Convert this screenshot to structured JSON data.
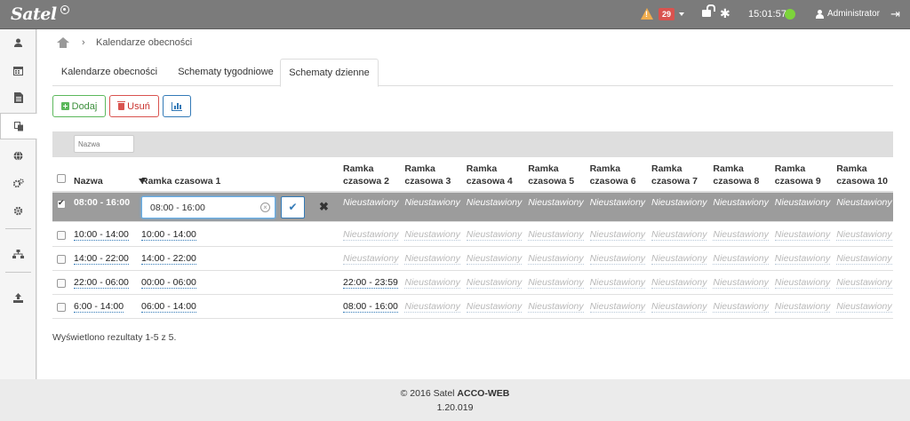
{
  "topbar": {
    "logo": "Satel",
    "alarm_count": "29",
    "clock": "15:01:57",
    "user": "Administrator",
    "colors": {
      "bar": "#7b7b7b",
      "warning": "#f0ad4e",
      "alarm": "#d9534f",
      "status_ok": "#7dd33b"
    }
  },
  "sidebar": {
    "items": [
      {
        "icon": "user-icon"
      },
      {
        "icon": "calendar-icon"
      },
      {
        "icon": "document-icon"
      },
      {
        "icon": "copy-icon",
        "active": true
      },
      {
        "icon": "globe-icon"
      },
      {
        "icon": "cogs-icon"
      },
      {
        "icon": "gear-icon"
      },
      {
        "icon": "network-icon"
      },
      {
        "icon": "upload-icon"
      }
    ]
  },
  "breadcrumb": {
    "current": "Kalendarze obecności"
  },
  "tabs": [
    {
      "label": "Kalendarze obecności"
    },
    {
      "label": "Schematy tygodniowe"
    },
    {
      "label": "Schematy dzienne",
      "active": true
    }
  ],
  "toolbar": {
    "add_label": "Dodaj",
    "delete_label": "Usuń"
  },
  "filter": {
    "placeholder": "Nazwa",
    "value": ""
  },
  "table": {
    "headers": {
      "name": "Nazwa",
      "frame1": "Ramka czasowa 1",
      "frames": [
        [
          "Ramka",
          "czasowa 2"
        ],
        [
          "Ramka",
          "czasowa 3"
        ],
        [
          "Ramka",
          "czasowa 4"
        ],
        [
          "Ramka",
          "czasowa 5"
        ],
        [
          "Ramka",
          "czasowa 6"
        ],
        [
          "Ramka",
          "czasowa 7"
        ],
        [
          "Ramka",
          "czasowa 8"
        ],
        [
          "Ramka",
          "czasowa 9"
        ],
        [
          "Ramka",
          "czasowa 10"
        ]
      ]
    },
    "rows": [
      {
        "name": "08:00 - 16:00",
        "frame1": "08:00 - 16:00",
        "checked": true,
        "editing": true,
        "frames": [
          "Nieustawiony",
          "Nieustawiony",
          "Nieustawiony",
          "Nieustawiony",
          "Nieustawiony",
          "Nieustawiony",
          "Nieustawiony",
          "Nieustawiony",
          "Nieustawiony"
        ]
      },
      {
        "name": "10:00 - 14:00",
        "frame1": "10:00 - 14:00",
        "checked": false,
        "frames": [
          "Nieustawiony",
          "Nieustawiony",
          "Nieustawiony",
          "Nieustawiony",
          "Nieustawiony",
          "Nieustawiony",
          "Nieustawiony",
          "Nieustawiony",
          "Nieustawiony"
        ]
      },
      {
        "name": "14:00 - 22:00",
        "frame1": "14:00 - 22:00",
        "checked": false,
        "frames": [
          "Nieustawiony",
          "Nieustawiony",
          "Nieustawiony",
          "Nieustawiony",
          "Nieustawiony",
          "Nieustawiony",
          "Nieustawiony",
          "Nieustawiony",
          "Nieustawiony"
        ]
      },
      {
        "name": "22:00 - 06:00",
        "frame1": "00:00 - 06:00",
        "checked": false,
        "frames": [
          "22:00 - 23:59",
          "Nieustawiony",
          "Nieustawiony",
          "Nieustawiony",
          "Nieustawiony",
          "Nieustawiony",
          "Nieustawiony",
          "Nieustawiony",
          "Nieustawiony"
        ]
      },
      {
        "name": "6:00 - 14:00",
        "frame1": "06:00 - 14:00",
        "checked": false,
        "frames": [
          "08:00 - 16:00",
          "Nieustawiony",
          "Nieustawiony",
          "Nieustawiony",
          "Nieustawiony",
          "Nieustawiony",
          "Nieustawiony",
          "Nieustawiony",
          "Nieustawiony"
        ]
      }
    ],
    "summary": "Wyświetlono rezultaty 1-5 z 5."
  },
  "footer": {
    "copyright_prefix": "© 2016 Satel ",
    "product": "ACCO-WEB",
    "version": "1.20.019"
  }
}
